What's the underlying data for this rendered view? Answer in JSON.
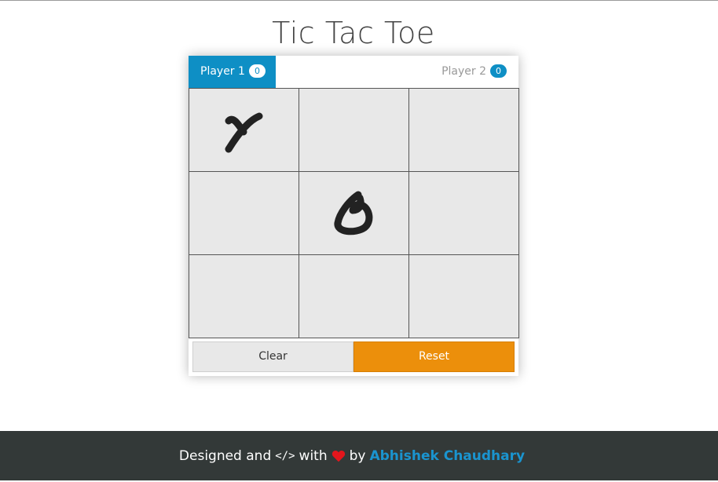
{
  "title": "Tic Tac Toe",
  "players": [
    {
      "label": "Player 1",
      "score": "0",
      "active": true
    },
    {
      "label": "Player 2",
      "score": "0",
      "active": false
    }
  ],
  "board": [
    [
      "X",
      "",
      ""
    ],
    [
      "",
      "O",
      ""
    ],
    [
      "",
      "",
      ""
    ]
  ],
  "buttons": {
    "clear": "Clear",
    "reset": "Reset"
  },
  "footer": {
    "designed": "Designed and",
    "code_symbol": "</>",
    "with": "with",
    "by": "by",
    "author": "Abhishek Chaudhary"
  },
  "colors": {
    "accent": "#0e8fc5",
    "reset": "#ec8f0b",
    "heart": "#e3161c",
    "footer_bg": "#333938"
  },
  "icons": {
    "code": "code-icon",
    "heart": "heart-icon",
    "x_mark": "x-mark-icon",
    "o_mark": "o-mark-icon"
  }
}
